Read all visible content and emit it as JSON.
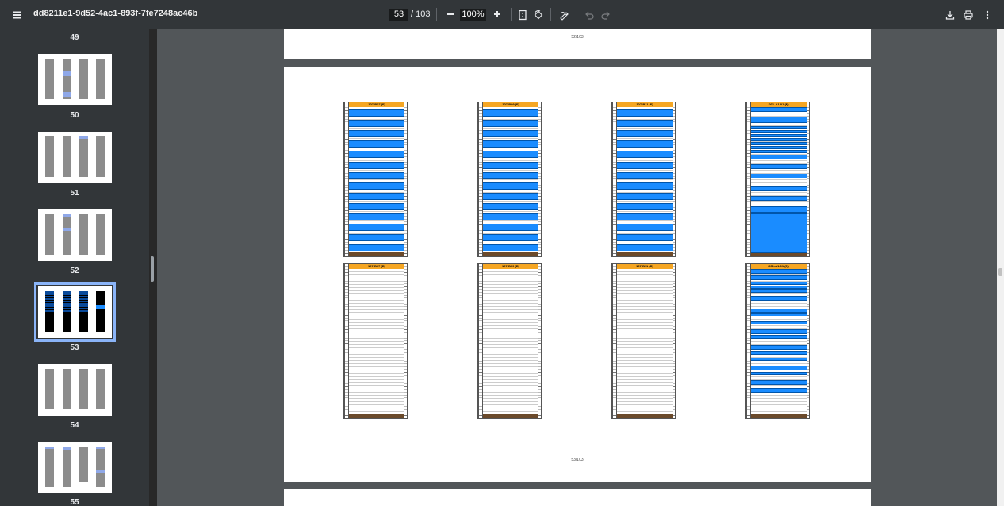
{
  "toolbar": {
    "title": "dd8211e1-9d52-4ac1-893f-7fe7248ac46b",
    "page_current": "53",
    "page_total": "/ 103",
    "zoom": "100%",
    "icons": [
      "menu-icon",
      "zoom-out-icon",
      "zoom-in-icon",
      "fit-page-icon",
      "rotate-icon",
      "annotate-icon",
      "undo-icon",
      "redo-icon",
      "download-icon",
      "print-icon",
      "more-icon"
    ]
  },
  "sidebar": {
    "thumbnails": [
      {
        "label": "49"
      },
      {
        "label": "50"
      },
      {
        "label": "51"
      },
      {
        "label": "52"
      },
      {
        "label": "53",
        "active": true
      },
      {
        "label": "54"
      },
      {
        "label": "55"
      }
    ]
  },
  "document": {
    "prev_page_footer": "52/103",
    "current_page_footer": "53/103",
    "racks_top": [
      {
        "label": "107-B07 (F)"
      },
      {
        "label": "107-B09 (F)"
      },
      {
        "label": "107-B11 (F)"
      },
      {
        "label": "201-A1-01 (F)"
      }
    ],
    "racks_bottom": [
      {
        "label": "107-B07 (B)"
      },
      {
        "label": "107-B09 (B)"
      },
      {
        "label": "107-B11 (B)"
      },
      {
        "label": "201-A1-01 (B)"
      }
    ]
  },
  "colors": {
    "rack_header": "#f5a623",
    "equipment": "#1a8cff",
    "rack_foot": "#6b4a2b",
    "toolbar_bg": "#323639",
    "viewer_bg": "#525659"
  }
}
